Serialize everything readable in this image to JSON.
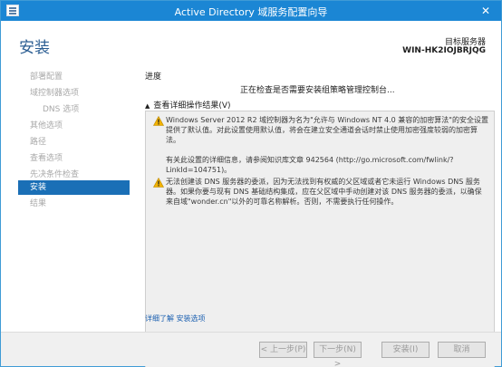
{
  "window": {
    "title": "Active Directory 域服务配置向导",
    "close_glyph": "✕"
  },
  "header": {
    "page_title": "安装",
    "target_server_label": "目标服务器",
    "target_server_value": "WIN-HK2IOJBRJQG"
  },
  "sidebar": {
    "items": [
      {
        "label": "部署配置",
        "state": "disabled"
      },
      {
        "label": "域控制器选项",
        "state": "disabled"
      },
      {
        "label": "DNS 选项",
        "state": "disabled",
        "sub": true
      },
      {
        "label": "其他选项",
        "state": "disabled"
      },
      {
        "label": "路径",
        "state": "disabled"
      },
      {
        "label": "查看选项",
        "state": "disabled"
      },
      {
        "label": "先决条件检查",
        "state": "disabled"
      },
      {
        "label": "安装",
        "state": "active"
      },
      {
        "label": "结果",
        "state": "disabled"
      }
    ]
  },
  "main": {
    "section_label": "进度",
    "status_text": "正在检查是否需要安装组策略管理控制台...",
    "details_toggle": "查看详细操作结果(V)",
    "results": [
      {
        "icon": "warning-icon",
        "paragraphs": [
          "Windows Server 2012 R2 域控制器为名为\"允许与 Windows NT 4.0 兼容的加密算法\"的安全设置提供了默认值。对此设置使用默认值，将会在建立安全通道会话时禁止使用加密强度较弱的加密算法。",
          "有关此设置的详细信息，请参阅知识库文章 942564 (http://go.microsoft.com/fwlink/?LinkId=104751)。"
        ]
      },
      {
        "icon": "warning-icon",
        "paragraphs": [
          "无法创建该 DNS 服务器的委派，因为无法找到有权威的父区域或者它未运行 Windows DNS 服务器。如果你要与现有 DNS 基础结构集成，应在父区域中手动创建对该 DNS 服务器的委派，以确保来自域\"wonder.cn\"以外的可靠名称解析。否则，不需要执行任何操作。"
        ]
      }
    ],
    "learn_more_link": "详细了解 安装选项"
  },
  "footer": {
    "prev_label": "< 上一步(P)",
    "next_label": "下一步(N) >",
    "install_label": "安装(I)",
    "cancel_label": "取消"
  },
  "colors": {
    "titlebar": "#1b86d4",
    "active_nav": "#1a6fb6",
    "page_title": "#2b5d92",
    "link": "#1a5fb0",
    "warning": "#f2b200"
  }
}
